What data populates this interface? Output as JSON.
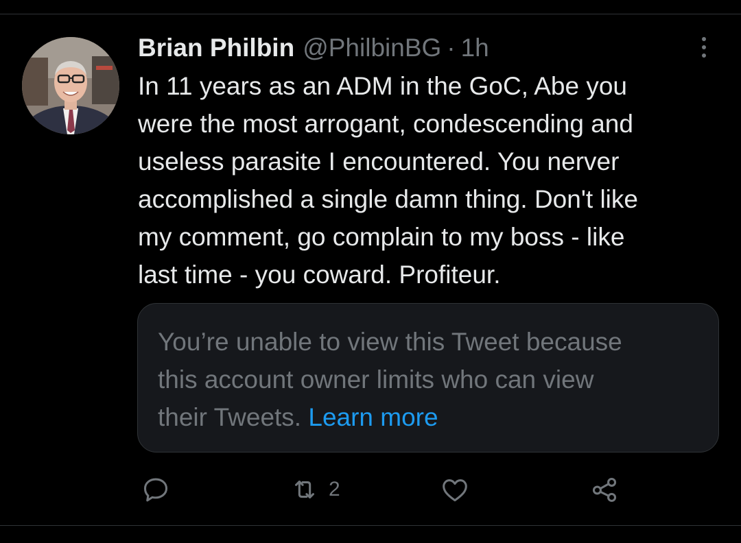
{
  "tweet": {
    "author": {
      "display_name": "Brian Philbin",
      "handle": "@PhilbinBG",
      "avatar_icon": "profile-photo"
    },
    "separator": "·",
    "time": "1h",
    "text_lines": [
      "In 11 years as an ADM in the GoC, Abe you",
      "were the most arrogant, condescending and",
      "useless parasite I encountered. You nerver",
      "accomplished a single damn thing. Don't like",
      "my comment, go complain to my boss - like",
      "last time - you coward. Profiteur."
    ],
    "more_icon": "vertical-ellipsis-icon"
  },
  "quoted_tweet": {
    "text_lines": [
      "You’re unable to view this Tweet because",
      "this account owner limits who can view",
      "their Tweets. "
    ],
    "link_text": "Learn more"
  },
  "actions": {
    "reply": {
      "icon": "reply-icon"
    },
    "retweet": {
      "icon": "retweet-icon",
      "count": "2"
    },
    "like": {
      "icon": "heart-icon"
    },
    "share": {
      "icon": "share-icon"
    }
  },
  "colors": {
    "background": "#000000",
    "primary_text": "#e7e9ea",
    "secondary_text": "#71767b",
    "link": "#1d9bf0",
    "card_background": "#16181c",
    "border": "#2f3336"
  }
}
